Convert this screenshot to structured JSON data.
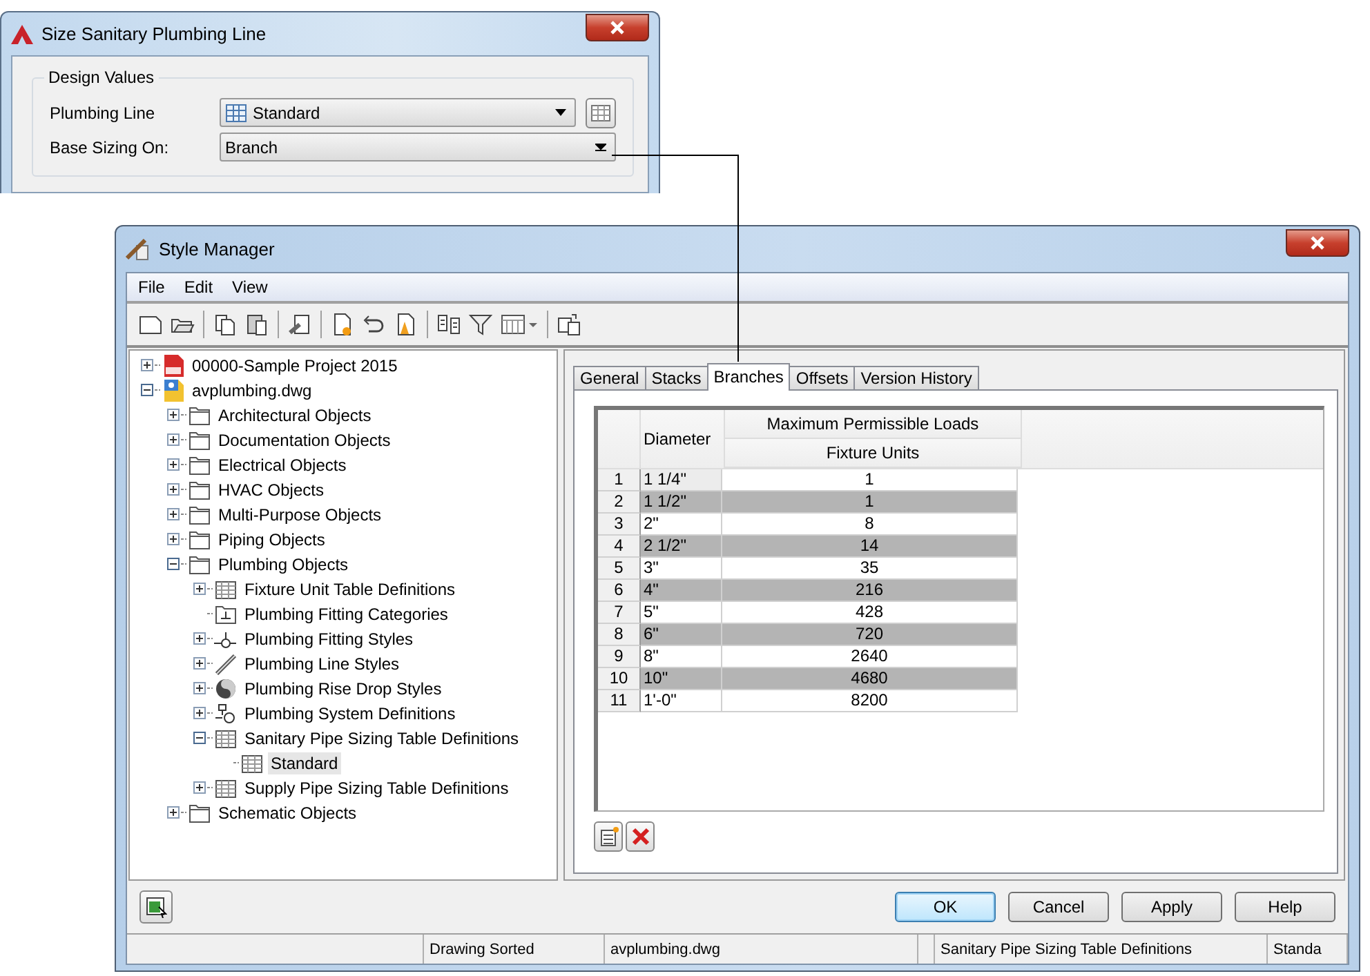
{
  "size_dialog": {
    "title": "Size Sanitary Plumbing Line",
    "group_title": "Design Values",
    "fields": [
      {
        "label": "Plumbing Line",
        "value": "Standard",
        "kind": "style-select"
      },
      {
        "label": "Base Sizing On:",
        "value": "Branch",
        "kind": "select"
      }
    ]
  },
  "style_manager": {
    "title": "Style Manager",
    "menu": [
      "File",
      "Edit",
      "View"
    ],
    "tree": [
      {
        "label": "00000-Sample Project 2015",
        "kind": "project",
        "expandable": true,
        "expanded": false,
        "selected": false
      },
      {
        "label": "avplumbing.dwg",
        "kind": "drawing",
        "expandable": true,
        "expanded": true,
        "selected": false,
        "children": [
          {
            "label": "Architectural Objects",
            "kind": "folder",
            "expandable": true,
            "expanded": false,
            "selected": false
          },
          {
            "label": "Documentation Objects",
            "kind": "folder",
            "expandable": true,
            "expanded": false,
            "selected": false
          },
          {
            "label": "Electrical Objects",
            "kind": "folder",
            "expandable": true,
            "expanded": false,
            "selected": false
          },
          {
            "label": "HVAC Objects",
            "kind": "folder",
            "expandable": true,
            "expanded": false,
            "selected": false
          },
          {
            "label": "Multi-Purpose Objects",
            "kind": "folder",
            "expandable": true,
            "expanded": false,
            "selected": false
          },
          {
            "label": "Piping Objects",
            "kind": "folder",
            "expandable": true,
            "expanded": false,
            "selected": false
          },
          {
            "label": "Plumbing Objects",
            "kind": "folder",
            "expandable": true,
            "expanded": true,
            "selected": false,
            "children": [
              {
                "label": "Fixture Unit Table Definitions",
                "kind": "table",
                "expandable": true,
                "expanded": false,
                "selected": false
              },
              {
                "label": "Plumbing Fitting Categories",
                "kind": "category",
                "expandable": false,
                "expanded": false,
                "selected": false
              },
              {
                "label": "Plumbing Fitting Styles",
                "kind": "fitting",
                "expandable": true,
                "expanded": false,
                "selected": false
              },
              {
                "label": "Plumbing Line Styles",
                "kind": "line",
                "expandable": true,
                "expanded": false,
                "selected": false
              },
              {
                "label": "Plumbing Rise Drop Styles",
                "kind": "risedrop",
                "expandable": true,
                "expanded": false,
                "selected": false
              },
              {
                "label": "Plumbing System Definitions",
                "kind": "system",
                "expandable": true,
                "expanded": false,
                "selected": false
              },
              {
                "label": "Sanitary Pipe Sizing Table Definitions",
                "kind": "table",
                "expandable": true,
                "expanded": true,
                "selected": false,
                "children": [
                  {
                    "label": "Standard",
                    "kind": "table",
                    "expandable": false,
                    "expanded": false,
                    "selected": true
                  }
                ]
              },
              {
                "label": "Supply Pipe Sizing Table Definitions",
                "kind": "table",
                "expandable": true,
                "expanded": false,
                "selected": false
              }
            ]
          },
          {
            "label": "Schematic Objects",
            "kind": "folder",
            "expandable": true,
            "expanded": false,
            "selected": false
          }
        ]
      }
    ],
    "tabs": [
      {
        "label": "General",
        "selected": false
      },
      {
        "label": "Stacks",
        "selected": false
      },
      {
        "label": "Branches",
        "selected": true
      },
      {
        "label": "Offsets",
        "selected": false
      },
      {
        "label": "Version History",
        "selected": false
      }
    ],
    "table": {
      "column_heading": "Diameter",
      "group_heading": "Maximum Permissible Loads",
      "sub_heading": "Fixture Units",
      "rows": [
        {
          "number": "1",
          "diameter": "1 1/4\"",
          "fixture_units": "1"
        },
        {
          "number": "2",
          "diameter": "1 1/2\"",
          "fixture_units": "1"
        },
        {
          "number": "3",
          "diameter": "2\"",
          "fixture_units": "8"
        },
        {
          "number": "4",
          "diameter": "2 1/2\"",
          "fixture_units": "14"
        },
        {
          "number": "5",
          "diameter": "3\"",
          "fixture_units": "35"
        },
        {
          "number": "6",
          "diameter": "4\"",
          "fixture_units": "216"
        },
        {
          "number": "7",
          "diameter": "5\"",
          "fixture_units": "428"
        },
        {
          "number": "8",
          "diameter": "6\"",
          "fixture_units": "720"
        },
        {
          "number": "9",
          "diameter": "8\"",
          "fixture_units": "2640"
        },
        {
          "number": "10",
          "diameter": "10\"",
          "fixture_units": "4680"
        },
        {
          "number": "11",
          "diameter": "1'-0\"",
          "fixture_units": "8200"
        }
      ]
    },
    "buttons": [
      {
        "label": "OK",
        "default": true
      },
      {
        "label": "Cancel",
        "default": false
      },
      {
        "label": "Apply",
        "default": false
      },
      {
        "label": "Help",
        "default": false
      }
    ],
    "status_bar": [
      "Drawing Sorted",
      "avplumbing.dwg",
      "Sanitary Pipe Sizing Table Definitions",
      "Standa"
    ]
  }
}
